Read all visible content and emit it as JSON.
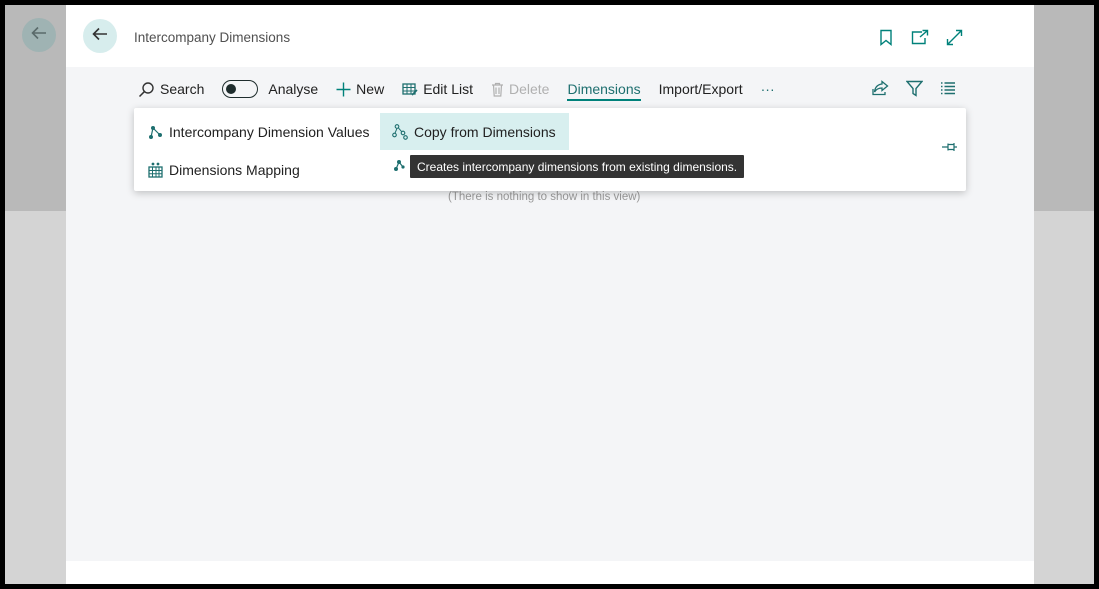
{
  "header": {
    "title": "Intercompany Dimensions"
  },
  "toolbar": {
    "search_label": "Search",
    "analyse_label": "Analyse",
    "new_label": "New",
    "edit_list_label": "Edit List",
    "delete_label": "Delete",
    "dimensions_label": "Dimensions",
    "import_export_label": "Import/Export",
    "more_label": "···"
  },
  "flyout": {
    "items": [
      {
        "label": "Intercompany Dimension Values"
      },
      {
        "label": "Copy from Dimensions"
      },
      {
        "label": "Dimensions Mapping"
      }
    ],
    "tooltip": "Creates intercompany dimensions from existing dimensions."
  },
  "content": {
    "empty_message": "(There is nothing to show in this view)"
  },
  "colors": {
    "accent": "#00817a",
    "hover_bg": "#d8efef",
    "tooltip_bg": "#333333"
  },
  "icons": {
    "outer_back": "arrow-left-icon",
    "inner_back": "arrow-left-icon",
    "bookmark": "bookmark-icon",
    "open_new": "open-in-new-window-icon",
    "expand": "expand-icon",
    "search": "search-icon",
    "new": "plus-icon",
    "edit_list": "edit-list-icon",
    "delete": "trash-icon",
    "share": "share-icon",
    "filter": "filter-icon",
    "list_view": "list-view-icon",
    "pin": "pin-icon"
  }
}
